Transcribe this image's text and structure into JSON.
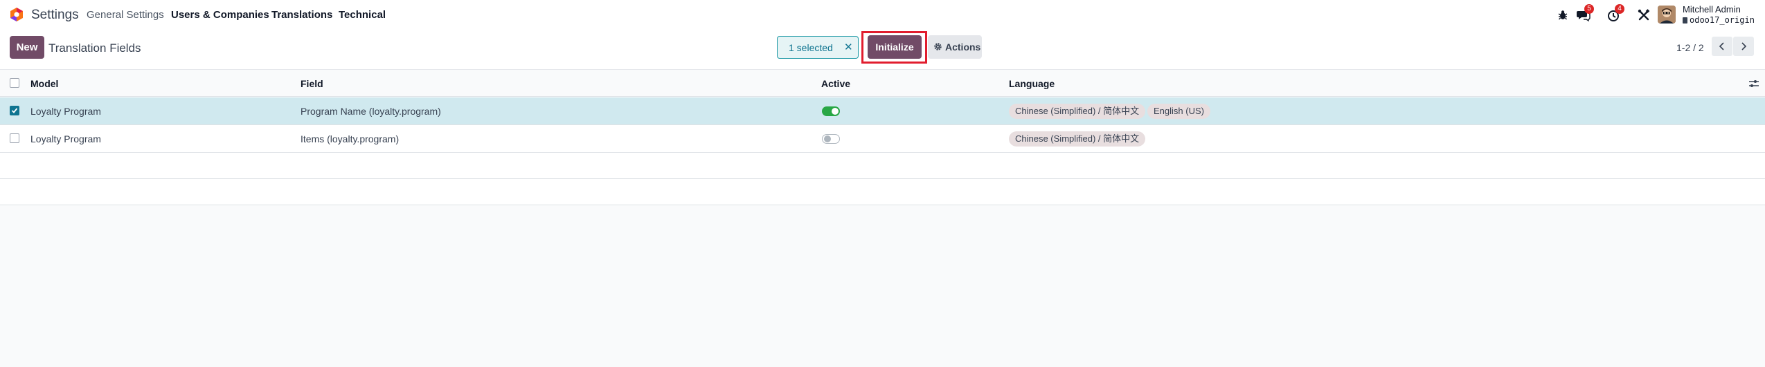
{
  "navbar": {
    "app_name": "Settings",
    "menus": [
      "General Settings",
      "Users & Companies",
      "Translations",
      "Technical"
    ],
    "messages_badge": "5",
    "activity_badge": "4",
    "user_name": "Mitchell Admin",
    "database": "odoo17_origin"
  },
  "control_panel": {
    "new_label": "New",
    "title": "Translation Fields",
    "selected_label": "1 selected",
    "clear_symbol": "✕",
    "initialize_label": "Initialize",
    "actions_label": "Actions",
    "pager": "1-2 / 2"
  },
  "list": {
    "headers": {
      "model": "Model",
      "field": "Field",
      "active": "Active",
      "language": "Language"
    },
    "rows": [
      {
        "selected": true,
        "model": "Loyalty Program",
        "field": "Program Name (loyalty.program)",
        "active": true,
        "languages": [
          "Chinese (Simplified) / 简体中文",
          "English (US)"
        ]
      },
      {
        "selected": false,
        "model": "Loyalty Program",
        "field": "Items (loyalty.program)",
        "active": false,
        "languages": [
          "Chinese (Simplified) / 简体中文"
        ]
      }
    ]
  },
  "colors": {
    "brand": "#714b67",
    "selected_row": "#d0e9ef",
    "toggle_on": "#28a745",
    "highlight_frame": "#e11d2e"
  }
}
